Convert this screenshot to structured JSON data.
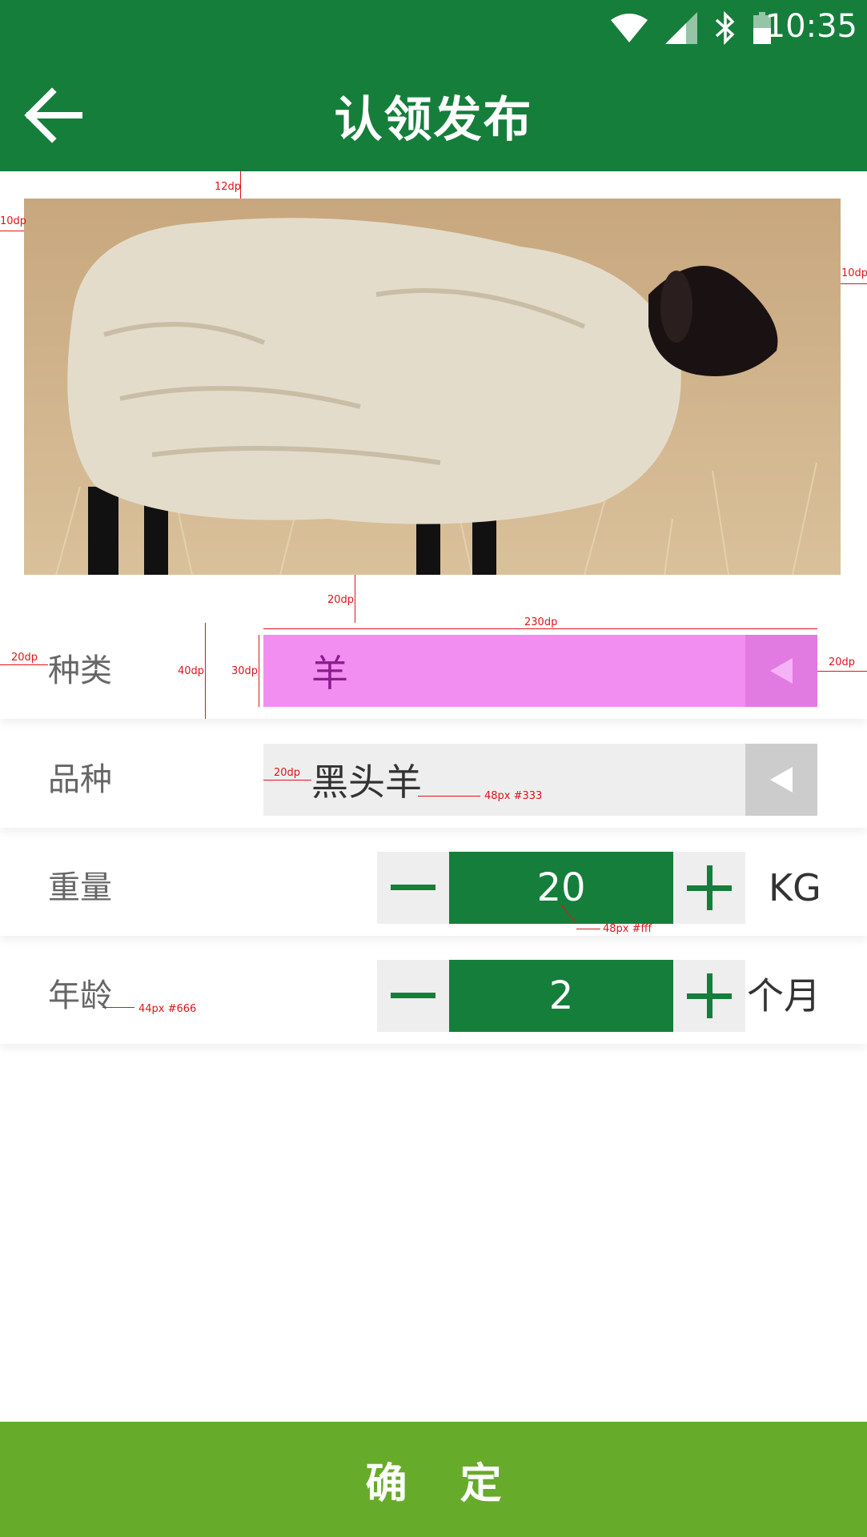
{
  "status_bar": {
    "time": "10:35",
    "icons": [
      "wifi-icon",
      "signal-icon",
      "bluetooth-icon",
      "battery-icon"
    ]
  },
  "app_bar": {
    "title": "认领发布",
    "back_icon": "arrow-left-icon"
  },
  "form": {
    "kind": {
      "label": "种类",
      "value": "羊"
    },
    "breed": {
      "label": "品种",
      "value": "黑头羊"
    },
    "weight": {
      "label": "重量",
      "value": "20",
      "unit": "KG"
    },
    "age": {
      "label": "年龄",
      "value": "2",
      "unit": "个月"
    }
  },
  "confirm_button": {
    "label": "确 定"
  },
  "annotations": {
    "img_top": "12dp",
    "img_left": "10dp",
    "img_right": "10dp",
    "img_bottom": "20dp",
    "field_width": "230dp",
    "row_left": "20dp",
    "row_height": "40dp",
    "field_height": "30dp",
    "row_right": "20dp",
    "text_padding": "20dp",
    "breed_font": "48px #333",
    "value_font": "48px #fff",
    "label_font": "44px #666"
  },
  "colors": {
    "primary": "#157e3b",
    "confirm": "#67ab2a",
    "kind_field": "#f28ef2",
    "kind_arrow": "#e17ae1",
    "breed_field": "#eeeeee",
    "breed_arrow": "#cccccc"
  }
}
